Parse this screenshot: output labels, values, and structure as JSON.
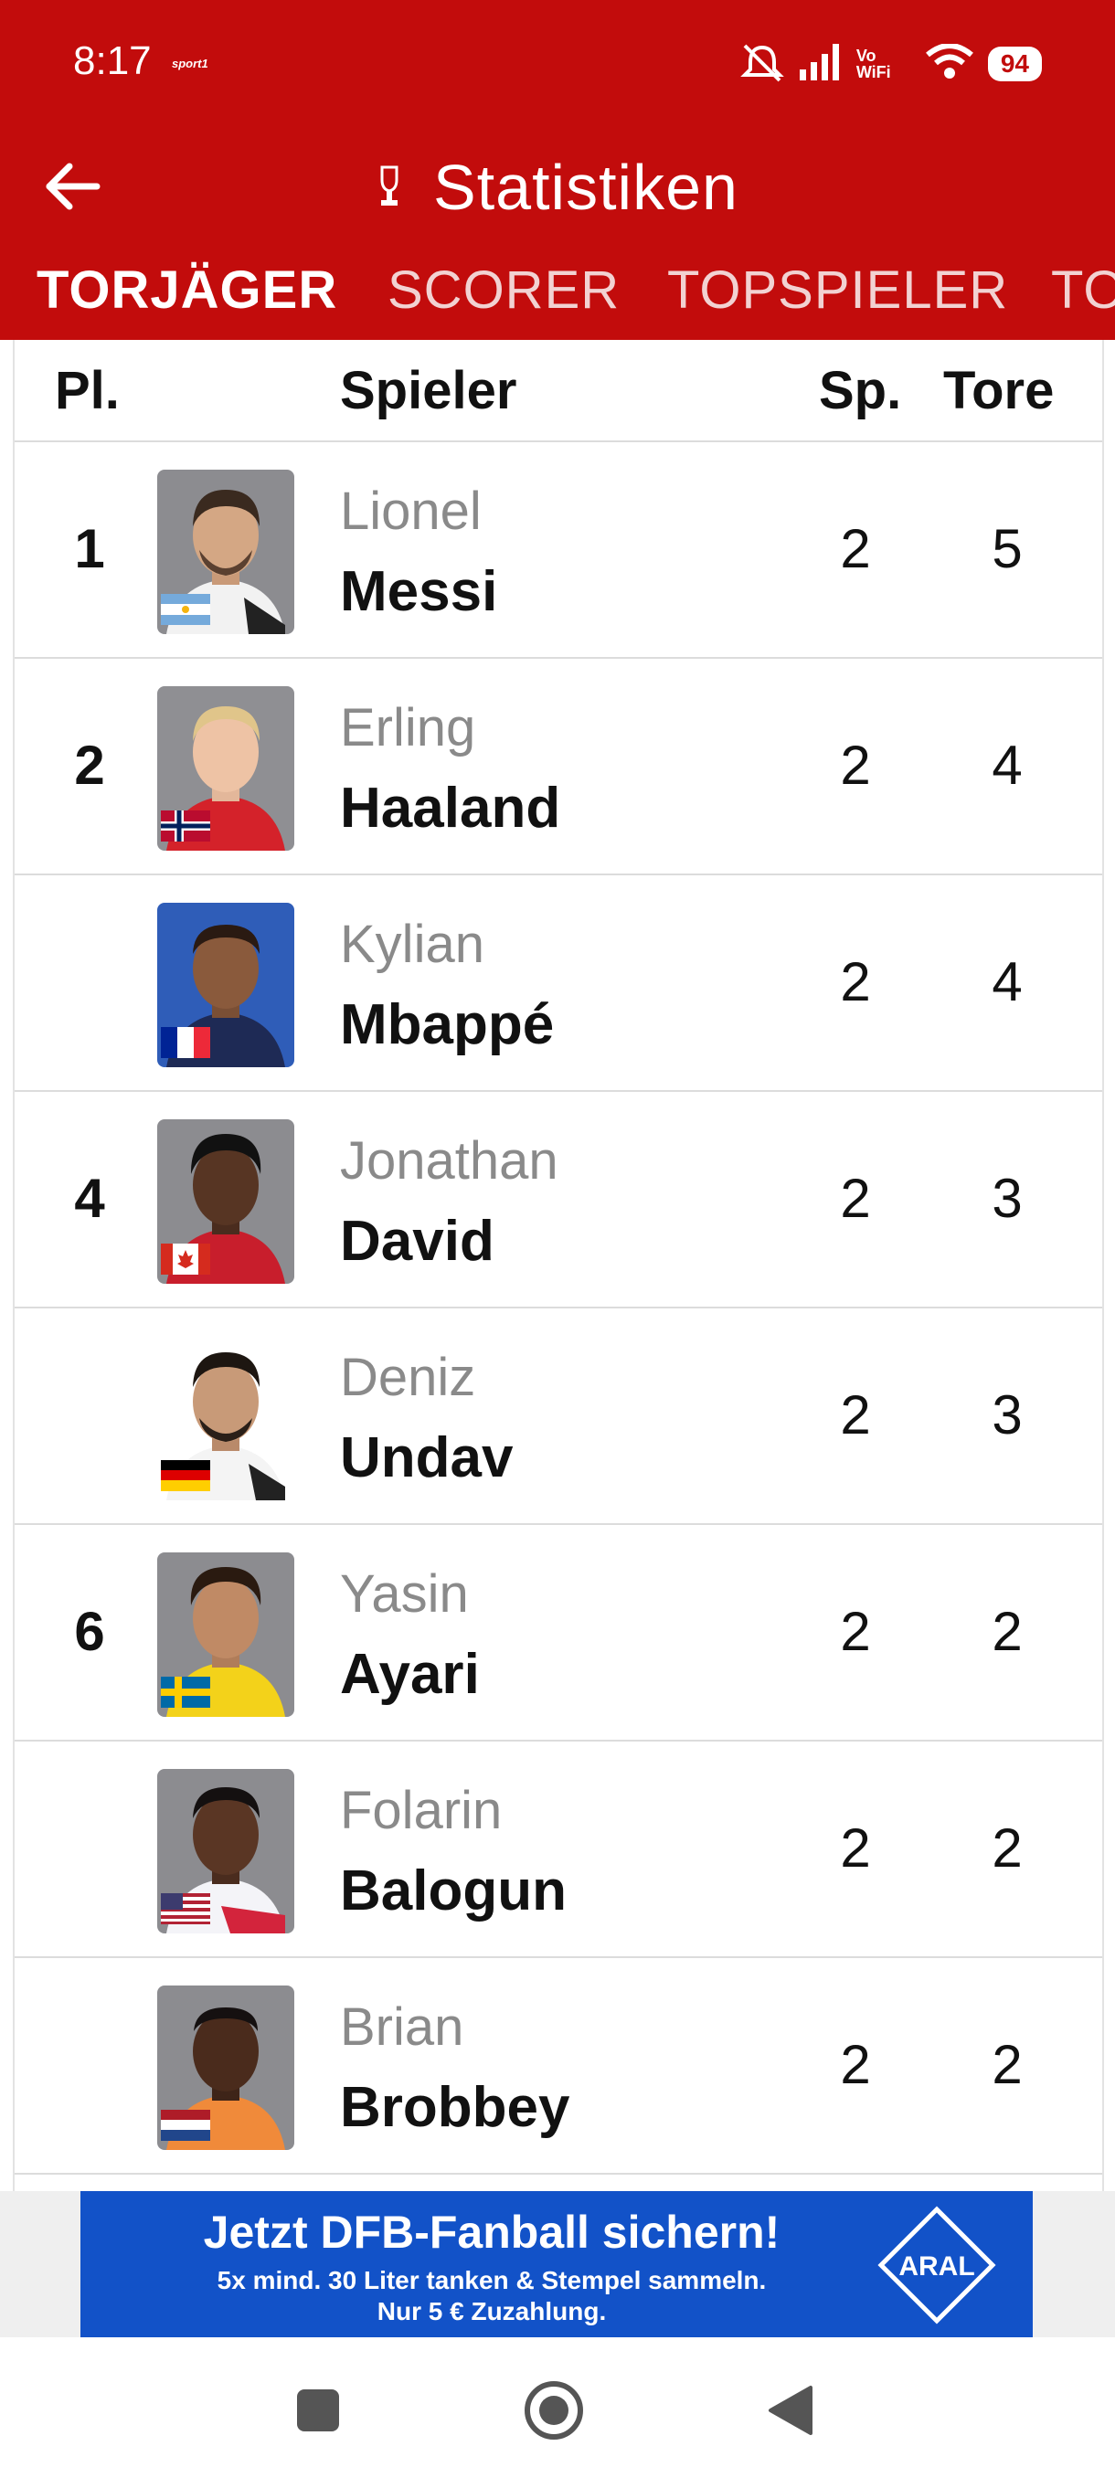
{
  "status_bar": {
    "time": "8:17",
    "app_tag": "sport1",
    "network": "Vo WiFi",
    "battery": "94"
  },
  "appbar": {
    "title": "Statistiken"
  },
  "tabs": [
    {
      "label": "TORJÄGER",
      "active": true
    },
    {
      "label": "SCORER",
      "active": false
    },
    {
      "label": "TOPSPIELER",
      "active": false
    },
    {
      "label": "TO",
      "active": false
    }
  ],
  "table": {
    "headers": {
      "rank": "Pl.",
      "player": "Spieler",
      "games": "Sp.",
      "goals": "Tore"
    },
    "rows": [
      {
        "rank": "1",
        "first": "Lionel",
        "last": "Messi",
        "games": "2",
        "goals": "5",
        "flag": "argentina-flag"
      },
      {
        "rank": "2",
        "first": "Erling",
        "last": "Haaland",
        "games": "2",
        "goals": "4",
        "flag": "norway-flag"
      },
      {
        "rank": "",
        "first": "Kylian",
        "last": "Mbappé",
        "games": "2",
        "goals": "4",
        "flag": "france-flag"
      },
      {
        "rank": "4",
        "first": "Jonathan",
        "last": "David",
        "games": "2",
        "goals": "3",
        "flag": "canada-flag"
      },
      {
        "rank": "",
        "first": "Deniz",
        "last": "Undav",
        "games": "2",
        "goals": "3",
        "flag": "germany-flag"
      },
      {
        "rank": "6",
        "first": "Yasin",
        "last": "Ayari",
        "games": "2",
        "goals": "2",
        "flag": "sweden-flag"
      },
      {
        "rank": "",
        "first": "Folarin",
        "last": "Balogun",
        "games": "2",
        "goals": "2",
        "flag": "usa-flag"
      },
      {
        "rank": "",
        "first": "Brian",
        "last": "Brobbey",
        "games": "2",
        "goals": "2",
        "flag": "netherlands-flag"
      }
    ]
  },
  "ad": {
    "headline": "Jetzt DFB-Fanball sichern!",
    "line1": "5x mind. 30 Liter tanken & Stempel sammeln.",
    "line2": "Nur 5 € Zuzahlung.",
    "logo_text": "ARAL"
  },
  "colors": {
    "brand_red": "#c20c0c",
    "ad_blue": "#1252c8"
  }
}
